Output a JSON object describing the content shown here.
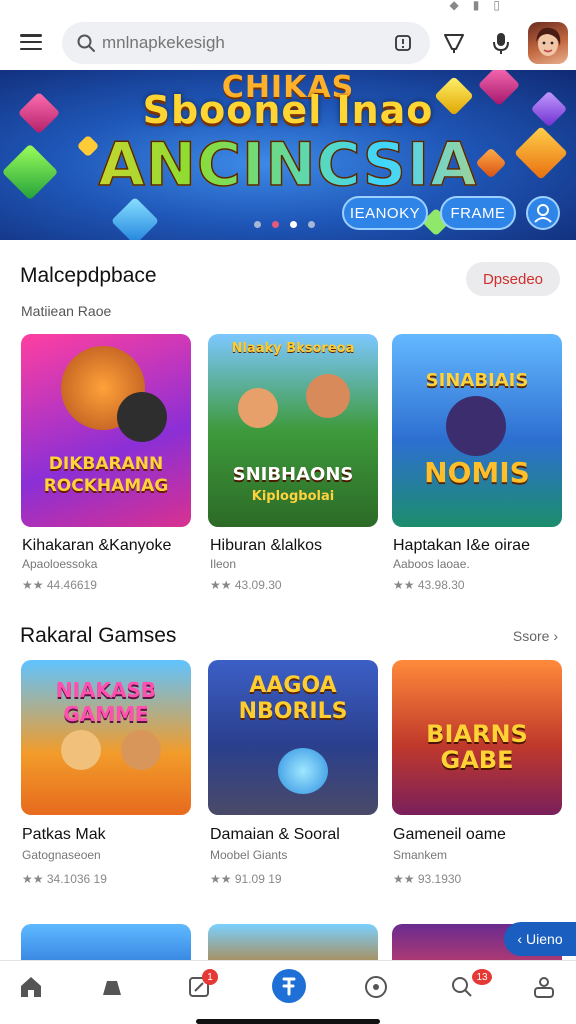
{
  "search": {
    "placeholder": "mnlnapkekesigh"
  },
  "banner": {
    "line1": "CHIKAS",
    "line2": "Sboonel Inao",
    "line3": "ANCINCSIA",
    "btn_left": "IEANOKY",
    "btn_right": "FRAME",
    "slide_count": 4,
    "active_slide": 3
  },
  "section1": {
    "title": "Malcepdpbace",
    "subtitle": "Matiiean Raoe",
    "chip": "Dpsedeo",
    "games": [
      {
        "art_line1": "DIKBARANN",
        "art_line2": "ROCKHAMAG",
        "name": "Kihakaran &Kanyoke",
        "dev": "Apaoloessoka",
        "rating": "★★ 44.46619"
      },
      {
        "art_line1": "SNIBHAONS",
        "art_line2": "Kiplogbolai",
        "art_top": "Nlaaky Bksoreoa",
        "name": "Hiburan &lalkos",
        "dev": "Ileon",
        "rating": "★★ 43.09.30"
      },
      {
        "art_line1": "SINABIAIS",
        "art_line2": "NOMIS",
        "name": "Haptakan I&e oirae",
        "dev": "Aaboos laoae.",
        "rating": "★★ 43.98.30"
      }
    ]
  },
  "section2": {
    "title": "Rakaral Gamses",
    "see_more": "Ssore ›",
    "games": [
      {
        "art_line1": "NIAKASB",
        "art_line2": "GAMME",
        "name": "Patkas Mak",
        "dev": "Gatognaseoen",
        "rating": "★★ 34.1036 19"
      },
      {
        "art_line1": "AAGOA",
        "art_line2": "NBORILS",
        "name": "Damaian & Sooral",
        "dev": "Moobel Giants",
        "rating": "★★ 91.09 19"
      },
      {
        "art_line1": "BIARNS",
        "art_line2": "GABE",
        "name": "Gameneil oame",
        "dev": "Smankem",
        "rating": "★★ 93.1930"
      }
    ]
  },
  "floating_button": "Uieno",
  "nav": {
    "badge_1": "1",
    "badge_2": "13"
  },
  "colors": {
    "accent": "#1e6fd6",
    "badge": "#e53935",
    "chip_text": "#d0302c"
  }
}
